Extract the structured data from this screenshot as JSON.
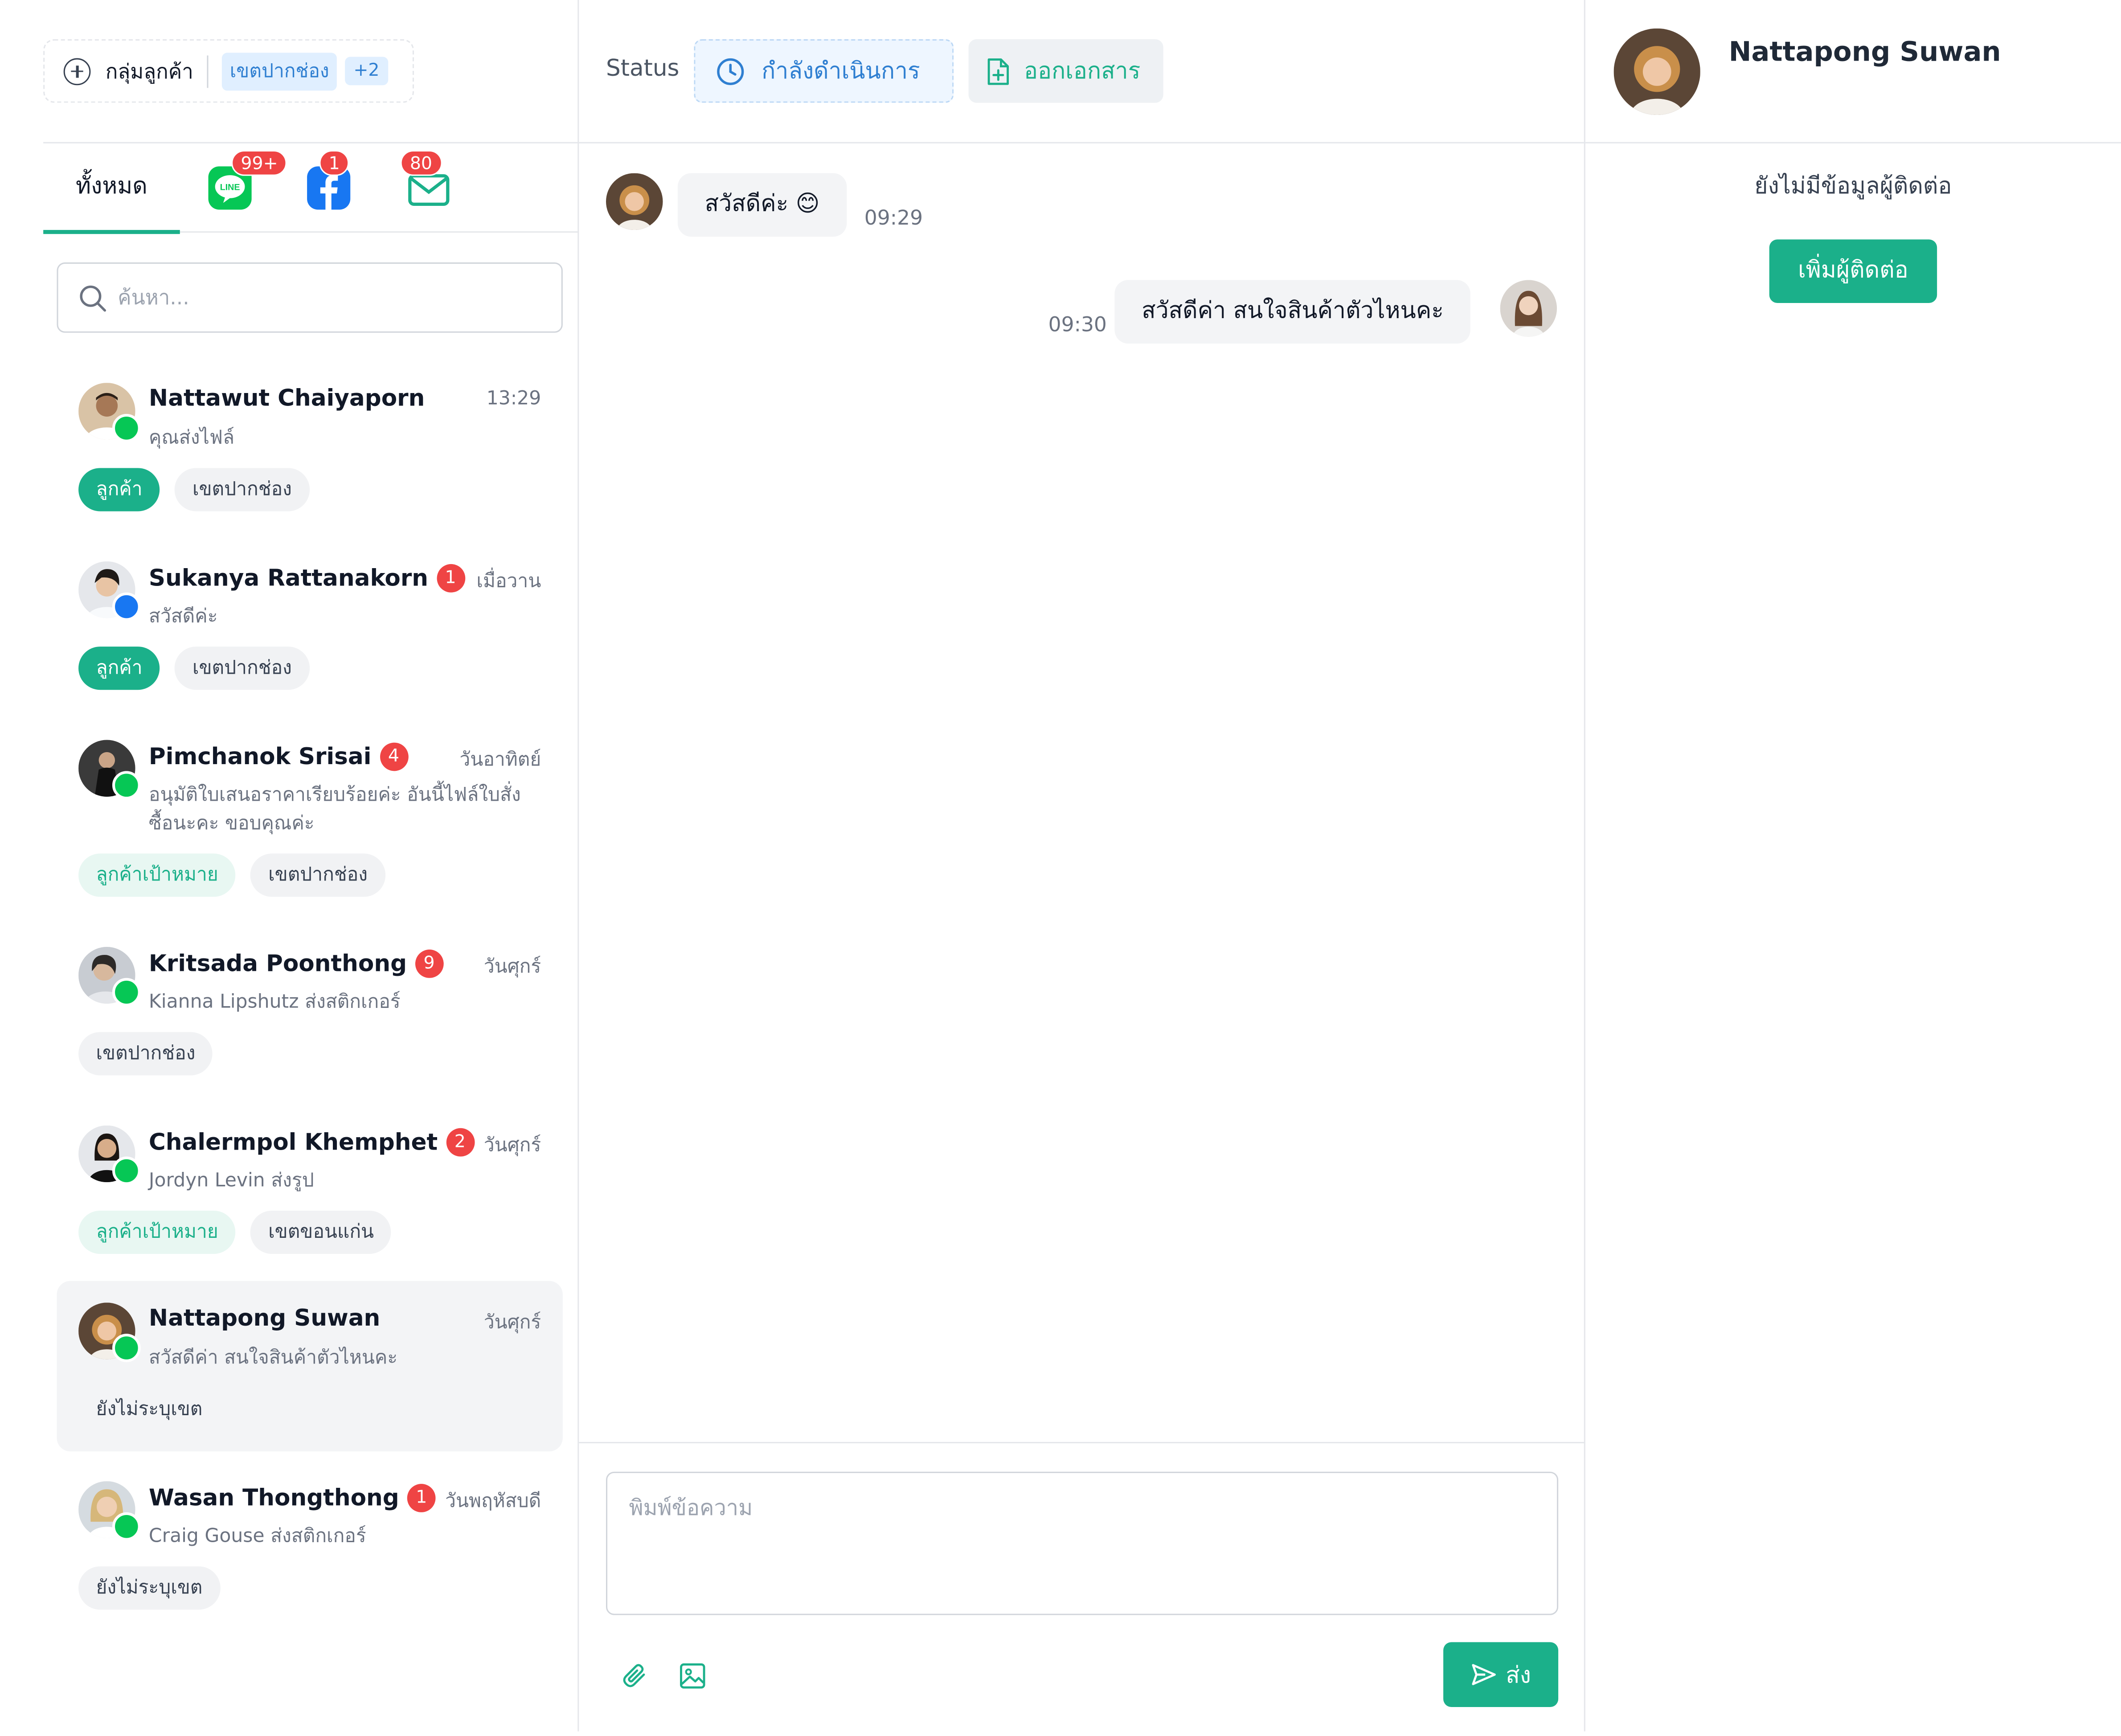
{
  "left": {
    "group": {
      "label": "กลุ่มลูกค้า",
      "chip": "เขตปากช่อง",
      "more": "+2"
    },
    "tabs": {
      "all": "ทั้งหมด",
      "line_badge": "99+",
      "facebook_badge": "1",
      "email_badge": "80"
    },
    "search": {
      "placeholder": "ค้นหา..."
    },
    "conversations": [
      {
        "name": "Nattawut Chaiyaporn",
        "unread": "",
        "time": "13:29",
        "message": "คุณส่งไฟล์",
        "channel": "line",
        "tags": [
          {
            "label": "ลูกค้า",
            "kind": "cust"
          },
          {
            "label": "เขตปากช่อง",
            "kind": "zone"
          }
        ]
      },
      {
        "name": "Sukanya Rattanakorn",
        "unread": "1",
        "time": "เมื่อวาน",
        "message": "สวัสดีค่ะ",
        "channel": "facebook",
        "tags": [
          {
            "label": "ลูกค้า",
            "kind": "cust"
          },
          {
            "label": "เขตปากช่อง",
            "kind": "zone"
          }
        ]
      },
      {
        "name": "Pimchanok Srisai",
        "unread": "4",
        "time": "วันอาทิตย์",
        "message": "อนุมัติใบเสนอราคาเรียบร้อยค่ะ อันนี้ไฟล์ใบสั่งซื้อนะคะ ขอบคุณค่ะ",
        "channel": "line",
        "tags": [
          {
            "label": "ลูกค้าเป้าหมาย",
            "kind": "target"
          },
          {
            "label": "เขตปากช่อง",
            "kind": "zone"
          }
        ]
      },
      {
        "name": "Kritsada Poonthong",
        "unread": "9",
        "time": "วันศุกร์",
        "message": "Kianna Lipshutz ส่งสติกเกอร์",
        "channel": "line",
        "tags": [
          {
            "label": "เขตปากช่อง",
            "kind": "zone"
          }
        ]
      },
      {
        "name": "Chalermpol Khemphet",
        "unread": "2",
        "time": "วันศุกร์",
        "message": "Jordyn Levin ส่งรูป",
        "channel": "line",
        "tags": [
          {
            "label": "ลูกค้าเป้าหมาย",
            "kind": "target"
          },
          {
            "label": "เขตขอนแก่น",
            "kind": "zone"
          }
        ]
      },
      {
        "name": "Nattapong Suwan",
        "unread": "",
        "time": "วันศุกร์",
        "message": "สวัสดีค่า สนใจสินค้าตัวไหนคะ",
        "channel": "line",
        "tags": [
          {
            "label": "ยังไม่ระบุเขต",
            "kind": "plain"
          }
        ]
      },
      {
        "name": "Wasan Thongthong",
        "unread": "1",
        "time": "วันพฤหัสบดี",
        "message": "Craig Gouse ส่งสติกเกอร์",
        "channel": "line",
        "tags": [
          {
            "label": "ยังไม่ระบุเขต",
            "kind": "zone"
          }
        ]
      }
    ]
  },
  "middle": {
    "status_label": "Status",
    "status_value": "กำลังดำเนินการ",
    "doc_button": "ออกเอกสาร",
    "messages": [
      {
        "from": "customer",
        "text": "สวัสดีค่ะ 😊",
        "time": "09:29"
      },
      {
        "from": "agent",
        "text": "สวัสดีค่า สนใจสินค้าตัวไหนคะ",
        "time": "09:30"
      }
    ],
    "composer_placeholder": "พิมพ์ข้อความ",
    "send_label": "ส่ง"
  },
  "right": {
    "name": "Nattapong Suwan",
    "empty_text": "ยังไม่มีข้อมูลผู้ติดต่อ",
    "add_button": "เพิ่มผู้ติดต่อ"
  },
  "colors": {
    "accent": "#1bb08a",
    "blue": "#2f7fd1",
    "unread": "#ef4444",
    "line": "#06c755",
    "facebook": "#1877f2"
  }
}
